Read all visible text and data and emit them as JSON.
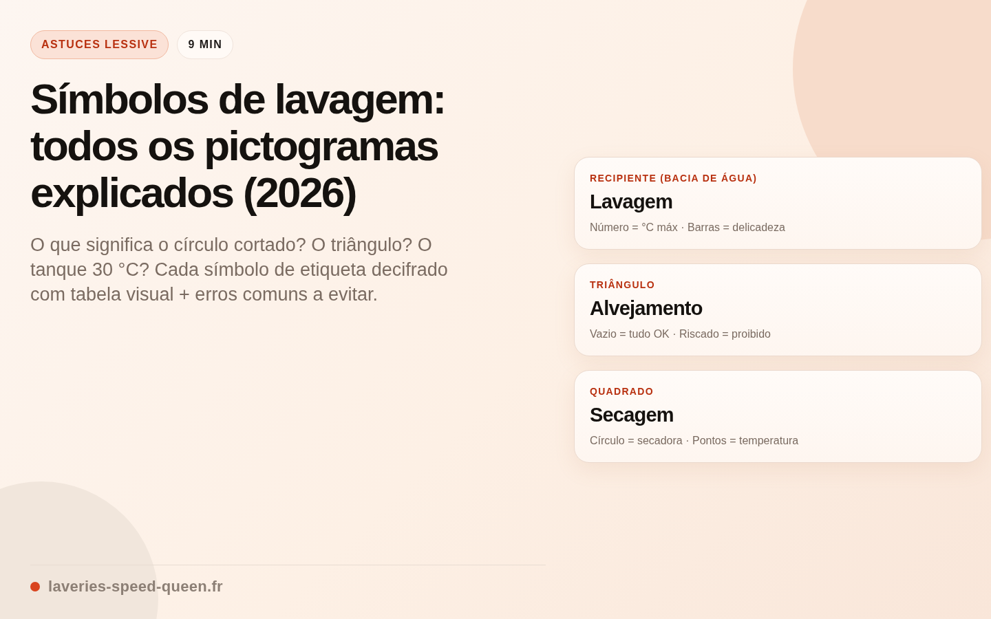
{
  "badges": [
    {
      "kind": "category",
      "label": "ASTUCES LESSIVE"
    },
    {
      "kind": "duration",
      "label": "9 MIN"
    }
  ],
  "title": "Símbolos de lavagem: todos os pictogramas explicados (2026)",
  "subtitle": "O que significa o círculo cortado? O triângulo? O tanque 30 °C? Cada símbolo de etiqueta decifrado com tabela visual + erros comuns a evitar.",
  "cards": [
    {
      "eyebrow": "RECIPIENTE (BACIA DE ÁGUA)",
      "heading": "Lavagem",
      "detail": "Número = °C máx · Barras = delicadeza"
    },
    {
      "eyebrow": "TRIÂNGULO",
      "heading": "Alvejamento",
      "detail": "Vazio = tudo OK · Riscado = proibido"
    },
    {
      "eyebrow": "QUADRADO",
      "heading": "Secagem",
      "detail": "Círculo = secadora · Pontos = temperatura"
    }
  ],
  "footer": {
    "site": "laveries-speed-queen.fr"
  }
}
